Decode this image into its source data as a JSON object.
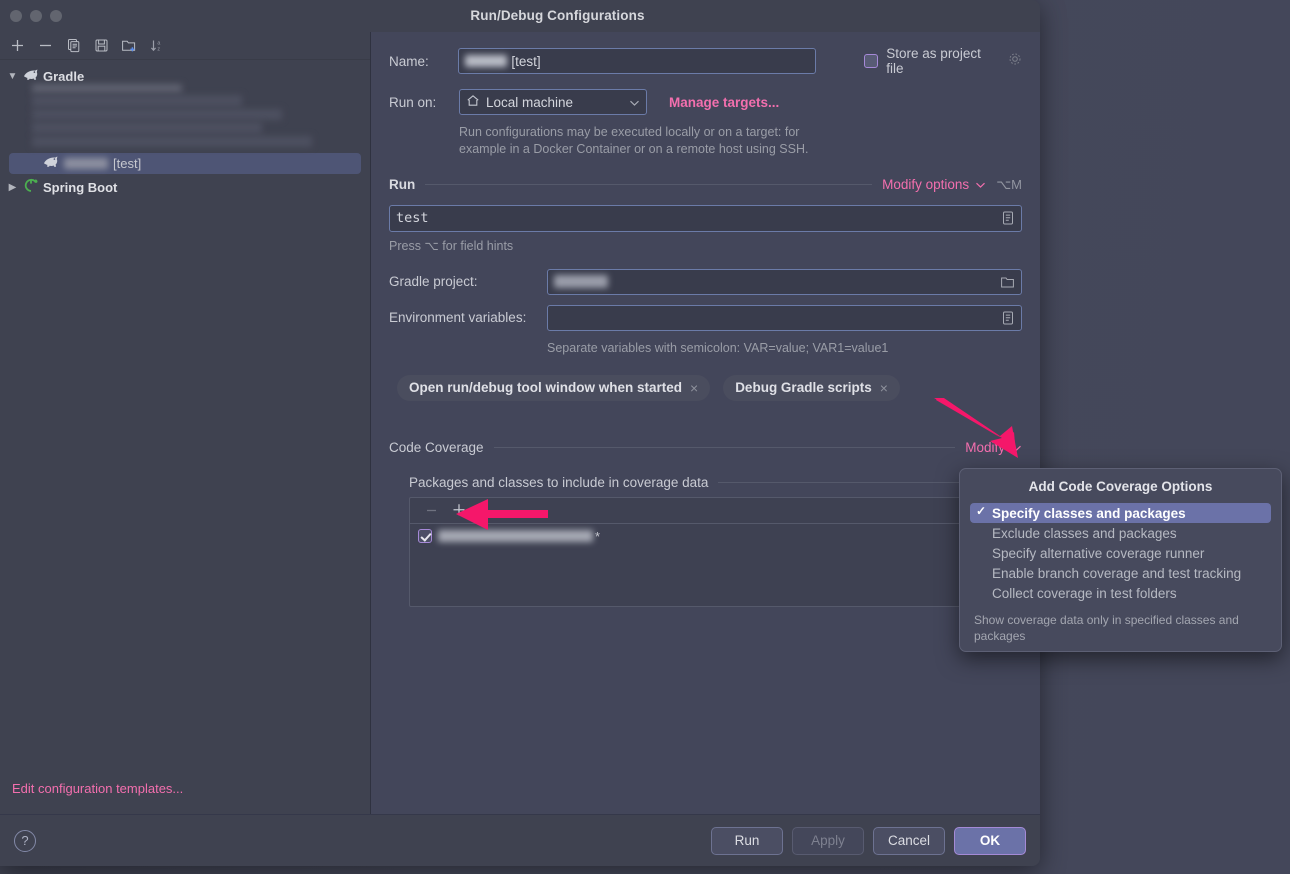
{
  "window": {
    "title": "Run/Debug Configurations",
    "traffic_lights": [
      "close",
      "minimize",
      "zoom"
    ]
  },
  "sidebar": {
    "toolbar": [
      {
        "name": "add-configuration-button",
        "icon": "plus-icon"
      },
      {
        "name": "remove-configuration-button",
        "icon": "minus-icon"
      },
      {
        "name": "copy-configuration-button",
        "icon": "copy-icon"
      },
      {
        "name": "save-configuration-button",
        "icon": "save-icon"
      },
      {
        "name": "new-folder-button",
        "icon": "new-folder-icon"
      },
      {
        "name": "sort-alphabetically-button",
        "icon": "sort-az-icon"
      }
    ],
    "tree": [
      {
        "label": "Gradle",
        "expanded": true,
        "icon": "gradle-icon"
      },
      {
        "label": "[test]",
        "selected": true,
        "icon": "gradle-icon",
        "redacted_prefix": true
      },
      {
        "label": "Spring Boot",
        "expanded": false,
        "icon": "spring-boot-icon"
      }
    ],
    "edit_templates_link": "Edit configuration templates..."
  },
  "form": {
    "name_label": "Name:",
    "name_value": "[test]",
    "store_as_project_file_label": "Store as project file",
    "store_as_project_file_checked": false,
    "store_gear_icon": "gear-icon",
    "run_on_label": "Run on:",
    "run_on_value": "Local machine",
    "run_on_icon": "home-icon",
    "manage_targets_link": "Manage targets...",
    "targets_help": "Run configurations may be executed locally or on a target: for example in a Docker Container or on a remote host using SSH.",
    "run_section_title": "Run",
    "modify_options_link": "Modify options",
    "modify_options_shortcut": "⌥M",
    "run_task_value": "test",
    "run_task_hint": "Press ⌥ for field hints",
    "gradle_project_label": "Gradle project:",
    "gradle_project_value": "",
    "environment_variables_label": "Environment variables:",
    "environment_variables_value": "",
    "environment_variables_hint": "Separate variables with semicolon: VAR=value; VAR1=value1",
    "chips": [
      {
        "label": "Open run/debug tool window when started",
        "close": "×"
      },
      {
        "label": "Debug Gradle scripts",
        "close": "×"
      }
    ]
  },
  "coverage": {
    "section_title": "Code Coverage",
    "modify_link": "Modify",
    "include_title": "Packages and classes to include in coverage data",
    "toolbar": [
      {
        "name": "remove-pattern-button",
        "icon": "minus-icon",
        "disabled": true
      },
      {
        "name": "add-pattern-button",
        "icon": "plus-icon",
        "disabled": false
      }
    ],
    "items": [
      {
        "checked": true,
        "suffix": "*",
        "redacted": true
      }
    ]
  },
  "popup": {
    "title": "Add Code Coverage Options",
    "items": [
      {
        "label": "Specify classes and packages",
        "selected": true,
        "checked": true
      },
      {
        "label": "Exclude classes and packages",
        "selected": false,
        "checked": false
      },
      {
        "label": "Specify alternative coverage runner",
        "selected": false,
        "checked": false
      },
      {
        "label": "Enable branch coverage and test tracking",
        "selected": false,
        "checked": false
      },
      {
        "label": "Collect coverage in test folders",
        "selected": false,
        "checked": false
      }
    ],
    "footer": "Show coverage data only in specified classes and packages"
  },
  "footer": {
    "help_icon": "?",
    "buttons": [
      {
        "label": "Run",
        "style": "normal",
        "name": "run-button"
      },
      {
        "label": "Apply",
        "style": "disabled",
        "name": "apply-button"
      },
      {
        "label": "Cancel",
        "style": "normal",
        "name": "cancel-button"
      },
      {
        "label": "OK",
        "style": "primary",
        "name": "ok-button"
      }
    ]
  },
  "annotations": {
    "arrow_color": "#f5176a",
    "arrows": [
      {
        "name": "arrow-pointing-to-modify",
        "target": "Modify"
      },
      {
        "name": "arrow-pointing-to-add-pattern",
        "target": "add-pattern-button"
      }
    ]
  },
  "colors": {
    "accent_link": "#f36fae",
    "selection": "#6b72a8",
    "window_bg": "#3f4250",
    "panel_bg": "#43465a",
    "arrow": "#f5176a"
  }
}
